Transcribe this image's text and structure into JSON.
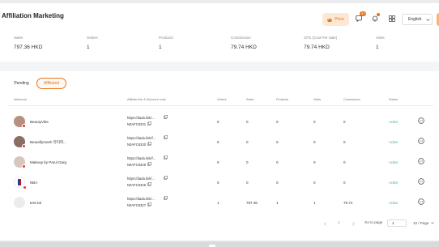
{
  "header": {
    "title": "Affiliation Marketing",
    "price_label": "Price",
    "notification_count": "37",
    "language": "English"
  },
  "stats": [
    {
      "label": "Sales",
      "value": "797.36 HKD"
    },
    {
      "label": "Orders",
      "value": "1"
    },
    {
      "label": "Products",
      "value": "1"
    },
    {
      "label": "Commission",
      "value": "79.74 HKD"
    },
    {
      "label": "CPS (Cost Per Sale)",
      "value": "79.74 HKD"
    },
    {
      "label": "Visits",
      "value": "1"
    }
  ],
  "tabs": {
    "pending": "Pending",
    "affiliated": "Affiliated"
  },
  "table": {
    "columns": [
      "Influencer",
      "Affiliate link & Discount code",
      "Orders",
      "Sales",
      "Products",
      "Visits",
      "Commission",
      "Status"
    ],
    "rows": [
      {
        "name": "BeautyVibe",
        "link": "https://dada.link/...",
        "code": "N0AFC6331",
        "orders": "0",
        "sales": "0",
        "products": "0",
        "visits": "0",
        "commission": "0",
        "status": "Active"
      },
      {
        "name": "Beautifymeeh 뷰티파...",
        "link": "https://dada.link/f...",
        "code": "N0AFC6330",
        "orders": "0",
        "sales": "0",
        "products": "0",
        "visits": "0",
        "commission": "0",
        "status": "Active"
      },
      {
        "name": "Makeup by Parul Garg",
        "link": "https://dada.link/f...",
        "code": "N0AFC6329",
        "orders": "0",
        "sales": "0",
        "products": "0",
        "visits": "0",
        "commission": "0",
        "status": "Active"
      },
      {
        "name": "NBA",
        "link": "https://dada.link/...",
        "code": "N0AFC6328",
        "orders": "0",
        "sales": "0",
        "products": "0",
        "visits": "0",
        "commission": "0",
        "status": "Active"
      },
      {
        "name": "test kol",
        "link": "https://dada.link/...",
        "code": "N0AFC6327",
        "orders": "1",
        "sales": "797.36",
        "products": "1",
        "visits": "1",
        "commission": "79.74",
        "status": "Active"
      }
    ]
  },
  "pagination": {
    "current_page": "1",
    "goto_label": "Go to page",
    "goto_value": "1",
    "page_size": "10 / Page"
  },
  "colors": {
    "accent": "#e8751a",
    "status_active": "#4caf80"
  },
  "icons": {
    "price": "crown-icon",
    "chat": "chat-icon",
    "bell": "bell-icon",
    "grid": "grid-icon",
    "copy": "copy-icon",
    "action": "more-circle-icon"
  }
}
